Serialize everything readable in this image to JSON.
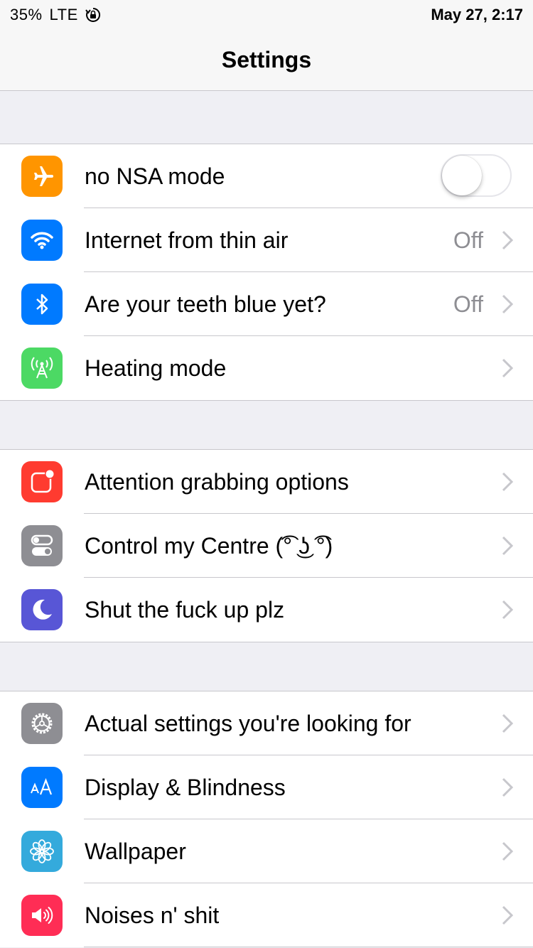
{
  "status_bar": {
    "battery": "35%",
    "network": "LTE",
    "orientation_lock_icon": "orientation-lock-icon",
    "datetime": "May 27, 2:17"
  },
  "nav": {
    "title": "Settings"
  },
  "groups": [
    {
      "rows": [
        {
          "label": "no NSA mode",
          "icon": "airplane-icon",
          "color": "#ff9500",
          "toggle": false
        },
        {
          "label": "Internet from thin air",
          "icon": "wifi-icon",
          "color": "#007aff",
          "value": "Off"
        },
        {
          "label": "Are your teeth blue yet?",
          "icon": "bluetooth-icon",
          "color": "#007aff",
          "value": "Off"
        },
        {
          "label": "Heating mode",
          "icon": "cellular-antenna-icon",
          "color": "#4cd964"
        }
      ]
    },
    {
      "rows": [
        {
          "label": "Attention grabbing options",
          "icon": "notifications-icon",
          "color": "#ff3b30"
        },
        {
          "label": "Control my Centre (͡° ͜ʖ ͡°)",
          "icon": "control-centre-icon",
          "color": "#8e8e93"
        },
        {
          "label": "Shut the fuck up plz",
          "icon": "moon-icon",
          "color": "#5856d6"
        }
      ]
    },
    {
      "rows": [
        {
          "label": "Actual settings you're looking for",
          "icon": "gear-icon",
          "color": "#8e8e93"
        },
        {
          "label": "Display & Blindness",
          "icon": "text-size-icon",
          "color": "#007aff"
        },
        {
          "label": "Wallpaper",
          "icon": "flower-icon",
          "color": "#34aadc"
        },
        {
          "label": "Noises n' shit",
          "icon": "speaker-icon",
          "color": "#ff2d55"
        }
      ]
    }
  ]
}
